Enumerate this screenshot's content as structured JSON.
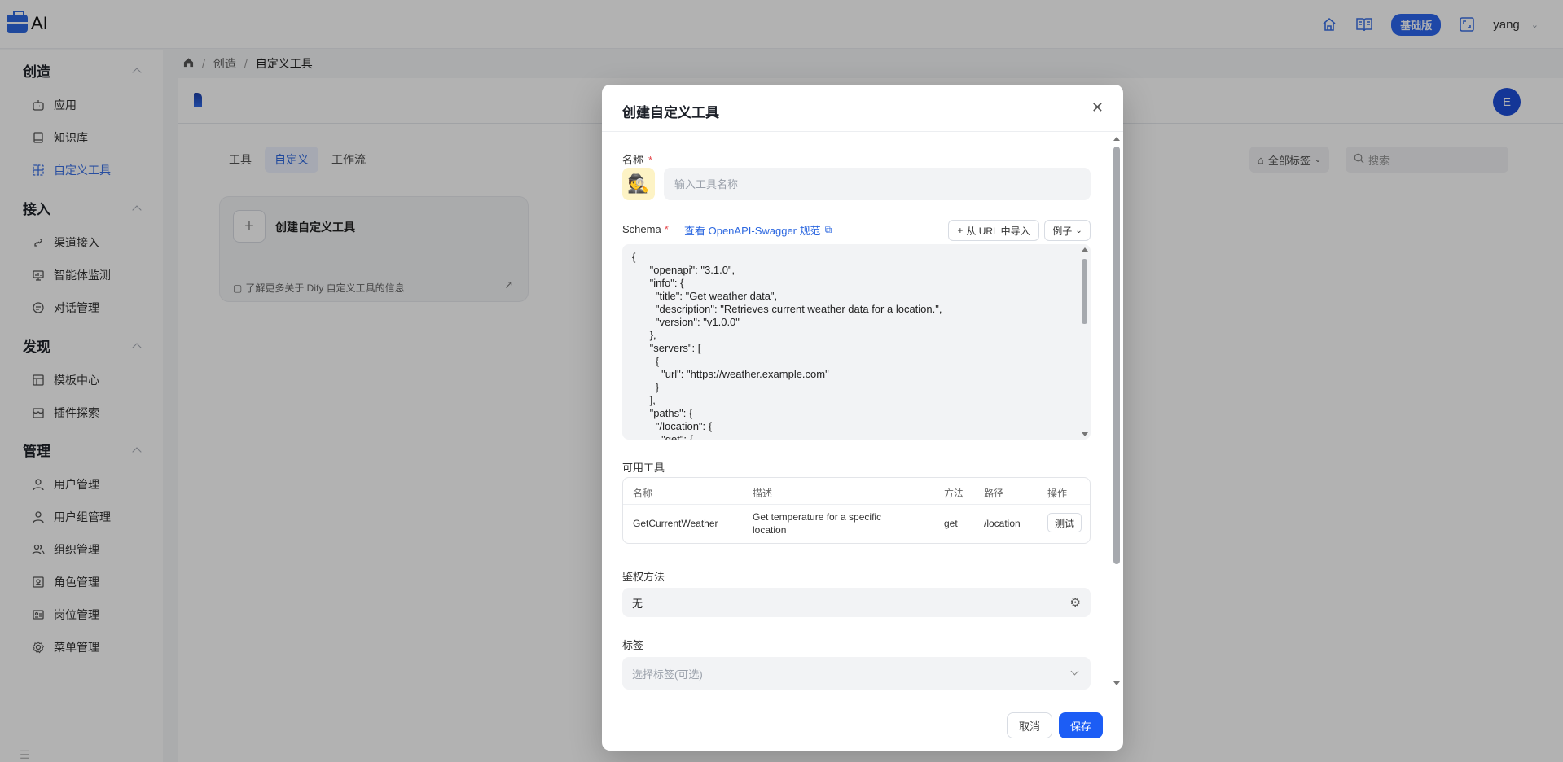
{
  "app": {
    "logo_text": "AI"
  },
  "topbar": {
    "badge": "基础版",
    "username": "yang"
  },
  "sidebar": {
    "sections": [
      {
        "title": "创造",
        "items": [
          "应用",
          "知识库",
          "自定义工具"
        ]
      },
      {
        "title": "接入",
        "items": [
          "渠道接入",
          "智能体监测",
          "对话管理"
        ]
      },
      {
        "title": "发现",
        "items": [
          "模板中心",
          "插件探索"
        ]
      },
      {
        "title": "管理",
        "items": [
          "用户管理",
          "用户组管理",
          "组织管理",
          "角色管理",
          "岗位管理",
          "菜单管理"
        ]
      }
    ],
    "active_item": "自定义工具"
  },
  "breadcrumb": {
    "sep": "/",
    "section": "创造",
    "current": "自定义工具"
  },
  "content": {
    "avatar_letter": "E",
    "tabs": [
      "工具",
      "自定义",
      "工作流"
    ],
    "active_tab": "自定义",
    "tag_filter": "全部标签",
    "search_placeholder": "搜索",
    "create_card_title": "创建自定义工具",
    "learn_more": "了解更多关于 Dify 自定义工具的信息"
  },
  "modal": {
    "title": "创建自定义工具",
    "name_label": "名称",
    "required_mark": "*",
    "name_placeholder": "输入工具名称",
    "schema_label": "Schema",
    "swagger_link": "查看 OpenAPI-Swagger 规范",
    "import_button": "从 URL 中导入",
    "example_button": "例子",
    "schema_text": "{\n      \"openapi\": \"3.1.0\",\n      \"info\": {\n        \"title\": \"Get weather data\",\n        \"description\": \"Retrieves current weather data for a location.\",\n        \"version\": \"v1.0.0\"\n      },\n      \"servers\": [\n        {\n          \"url\": \"https://weather.example.com\"\n        }\n      ],\n      \"paths\": {\n        \"/location\": {\n          \"get\": {",
    "tools_label": "可用工具",
    "table_headers": [
      "名称",
      "描述",
      "方法",
      "路径",
      "操作"
    ],
    "tool_row": {
      "name": "GetCurrentWeather",
      "desc_line1": "Get temperature for a specific",
      "desc_line2": "location",
      "method": "get",
      "path": "/location",
      "action": "测试"
    },
    "auth_label": "鉴权方法",
    "auth_value": "无",
    "tags_label": "标签",
    "tags_placeholder": "选择标签(可选)",
    "cancel_button": "取消",
    "save_button": "保存"
  },
  "colors": {
    "accent": "#2d68e0",
    "primary_button": "#1c5df5",
    "badge": "#2b66ef",
    "avatar": "#1e4ed8"
  }
}
